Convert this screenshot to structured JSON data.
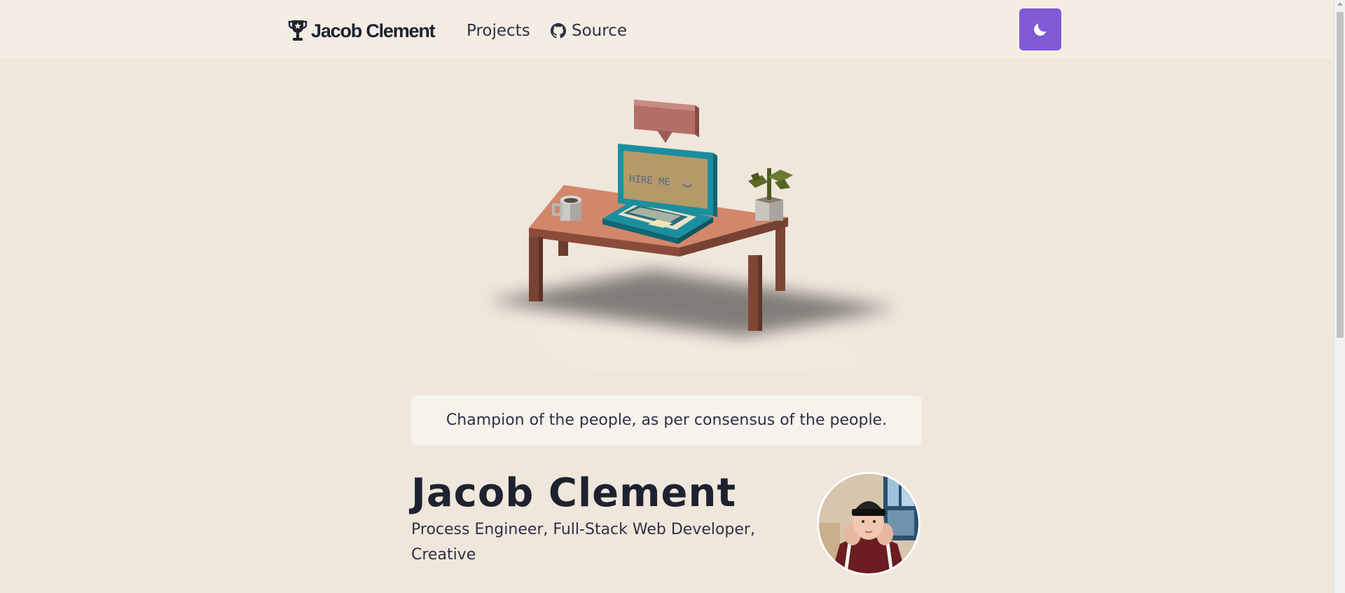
{
  "navbar": {
    "brand": {
      "name": "Jacob Clement",
      "icon": "trophy-icon"
    },
    "links": [
      {
        "label": "Projects"
      },
      {
        "label": "Source",
        "icon": "github-icon"
      }
    ],
    "theme_toggle": {
      "icon": "moon-icon",
      "color": "#805ad5"
    }
  },
  "hero": {
    "scene": {
      "screen_text": "HIRE ME",
      "objects": [
        "speech-bubble",
        "laptop",
        "coffee-mug",
        "potted-plant",
        "desk"
      ]
    },
    "tagline": "Champion of the people, as per consensus of the people."
  },
  "profile": {
    "name": "Jacob Clement",
    "role": "Process Engineer, Full-Stack Web Developer, Creative",
    "avatar": "profile-photo"
  },
  "colors": {
    "background": "#efe7dc",
    "navbar": "#f4ede4",
    "accent": "#805ad5",
    "text": "#1e2230"
  }
}
